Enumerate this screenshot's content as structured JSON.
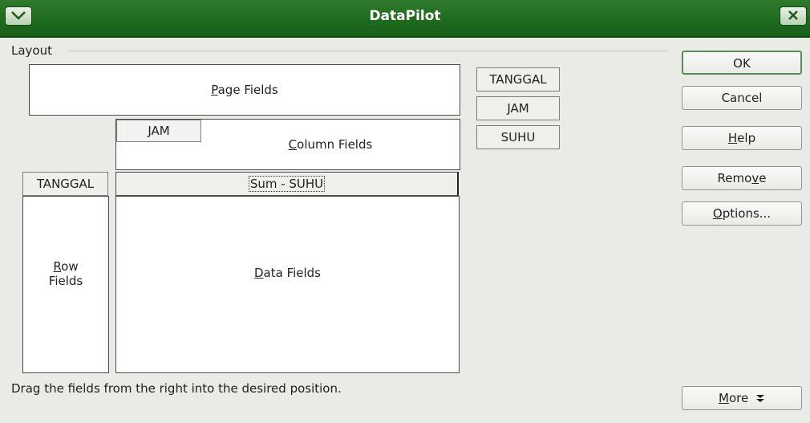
{
  "window": {
    "title": "DataPilot"
  },
  "layout": {
    "group_label": "Layout",
    "page_fields": {
      "pre": "",
      "u": "P",
      "post": "age Fields"
    },
    "column_fields": {
      "pre": "",
      "u": "C",
      "post": "olumn Fields",
      "placed": "JAM"
    },
    "row_fields": {
      "u": "R",
      "line1_post": "ow",
      "line2": "Fields",
      "placed": "TANGGAL"
    },
    "data_fields": {
      "pre": "",
      "u": "D",
      "post": "ata Fields",
      "placed": "Sum - SUHU"
    },
    "hint": "Drag the fields from the right into the desired position."
  },
  "available_fields": [
    "TANGGAL",
    "JAM",
    "SUHU"
  ],
  "buttons": {
    "ok": "OK",
    "cancel": "Cancel",
    "help": {
      "u": "H",
      "post": "elp"
    },
    "remove": {
      "pre": "Remo",
      "u": "v",
      "post": "e"
    },
    "options": {
      "u": "O",
      "post": "ptions..."
    },
    "more": {
      "u": "M",
      "post": "ore",
      "arrow": "double-chevron-down-icon"
    }
  },
  "colors": {
    "titlebar": "#1e6a1d",
    "dialog_bg": "#e9ebe6"
  }
}
